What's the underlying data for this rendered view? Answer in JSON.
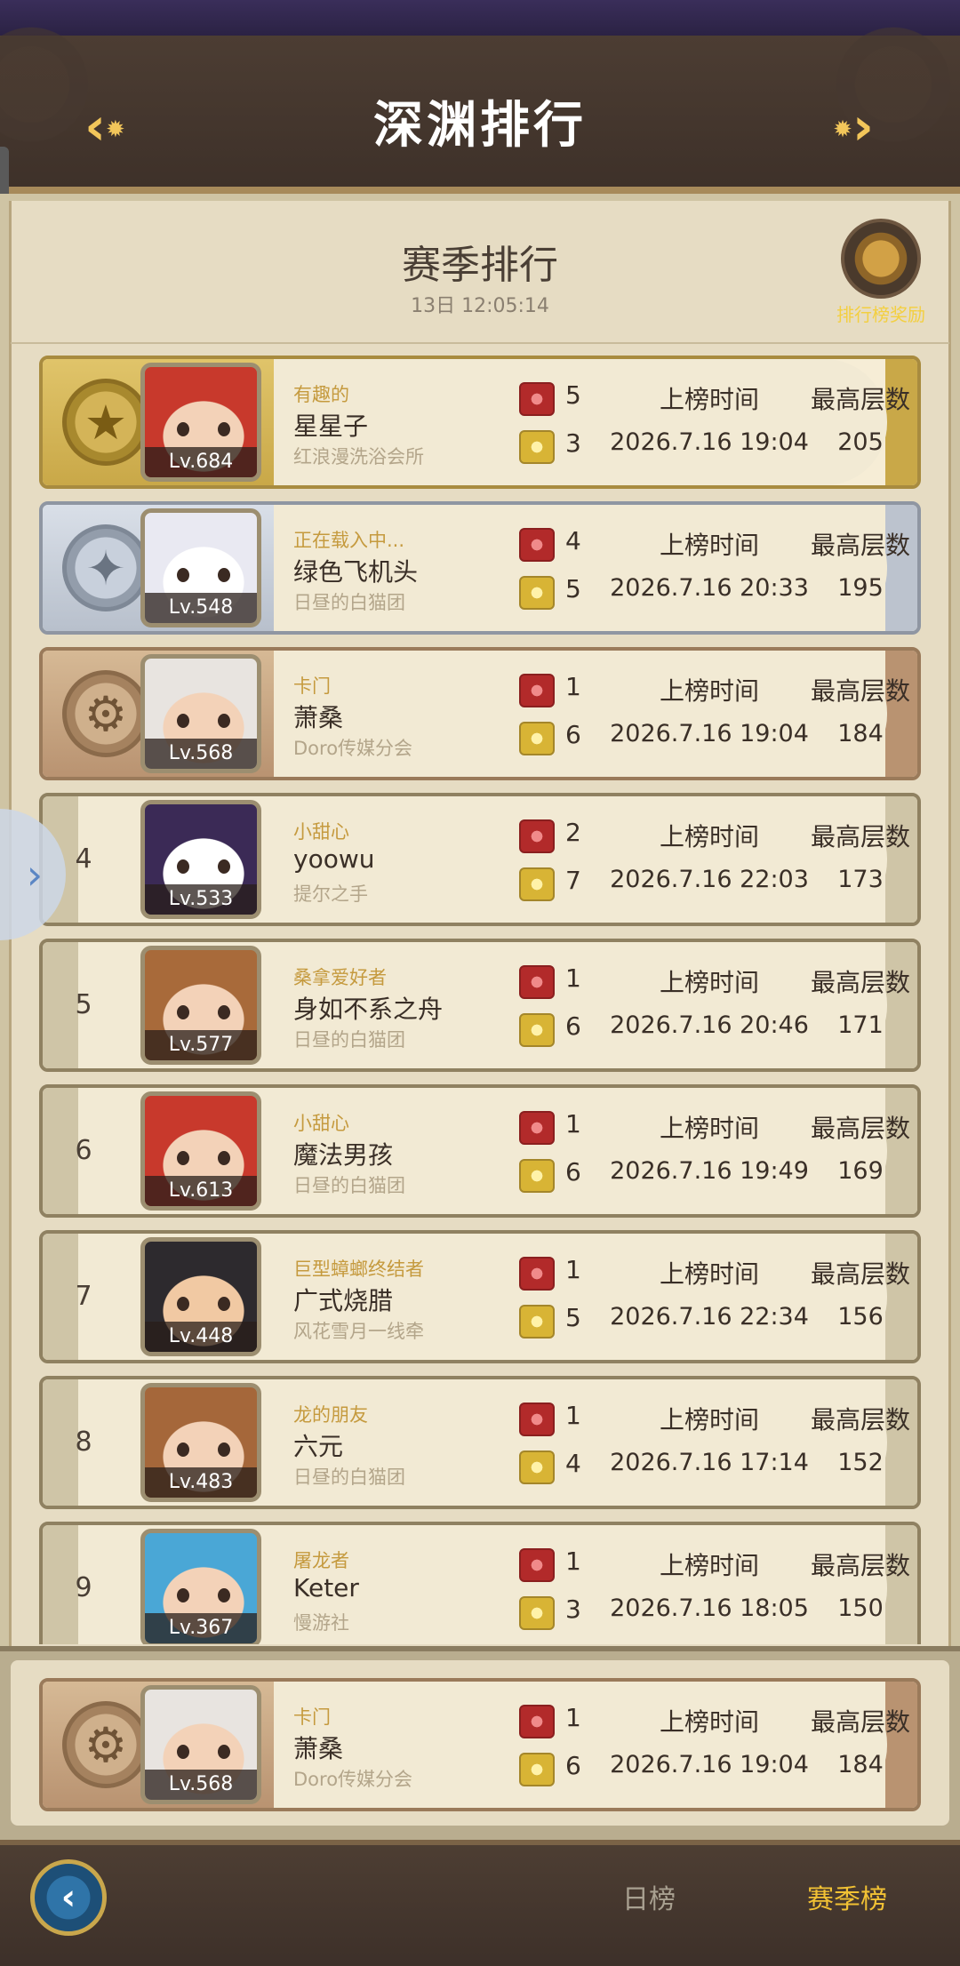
{
  "header": {
    "title": "深渊排行",
    "prev_icon": "arrow-left-gear-icon",
    "next_icon": "arrow-right-gear-icon"
  },
  "season": {
    "title": "赛季排行",
    "time_left": "13日 12:05:14",
    "reward_label": "排行榜奖励"
  },
  "columns": {
    "time": "上榜时间",
    "floor": "最高层数"
  },
  "rows": [
    {
      "rank": "1",
      "medal": "gold",
      "level": "Lv.684",
      "title": "有趣的",
      "name": "星星子",
      "guild": "红浪漫洗浴会所",
      "red": "5",
      "yellow": "3",
      "time": "2026.7.16 19:04",
      "floor": "205",
      "hair": "#c8392c",
      "skin": "#f3d2b8"
    },
    {
      "rank": "2",
      "medal": "silver",
      "level": "Lv.548",
      "title": "正在载入中...",
      "name": "绿色飞机头",
      "guild": "日昼的白猫团",
      "red": "4",
      "yellow": "5",
      "time": "2026.7.16 20:33",
      "floor": "195",
      "hair": "#e9e9f2",
      "skin": "#ffffff"
    },
    {
      "rank": "3",
      "medal": "bronze",
      "level": "Lv.568",
      "title": "卡门",
      "name": "萧桑",
      "guild": "Doro传媒分会",
      "red": "1",
      "yellow": "6",
      "time": "2026.7.16 19:04",
      "floor": "184",
      "hair": "#e8e4e0",
      "skin": "#f3d2b8"
    },
    {
      "rank": "4",
      "medal": "",
      "level": "Lv.533",
      "title": "小甜心",
      "name": "yoowu",
      "guild": "提尔之手",
      "red": "2",
      "yellow": "7",
      "time": "2026.7.16 22:03",
      "floor": "173",
      "hair": "#3b2a56",
      "skin": "#ffffff"
    },
    {
      "rank": "5",
      "medal": "",
      "level": "Lv.577",
      "title": "桑拿爱好者",
      "name": "身如不系之舟",
      "guild": "日昼的白猫团",
      "red": "1",
      "yellow": "6",
      "time": "2026.7.16 20:46",
      "floor": "171",
      "hair": "#a86a3a",
      "skin": "#f3d2b8"
    },
    {
      "rank": "6",
      "medal": "",
      "level": "Lv.613",
      "title": "小甜心",
      "name": "魔法男孩",
      "guild": "日昼的白猫团",
      "red": "1",
      "yellow": "6",
      "time": "2026.7.16 19:49",
      "floor": "169",
      "hair": "#c8392c",
      "skin": "#f3d2b8"
    },
    {
      "rank": "7",
      "medal": "",
      "level": "Lv.448",
      "title": "巨型蟑螂终结者",
      "name": "广式烧腊",
      "guild": "风花雪月一线牵",
      "red": "1",
      "yellow": "5",
      "time": "2026.7.16 22:34",
      "floor": "156",
      "hair": "#2d2a2e",
      "skin": "#f1c9a3"
    },
    {
      "rank": "8",
      "medal": "",
      "level": "Lv.483",
      "title": "龙的朋友",
      "name": "六元",
      "guild": "日昼的白猫团",
      "red": "1",
      "yellow": "4",
      "time": "2026.7.16 17:14",
      "floor": "152",
      "hair": "#a5673a",
      "skin": "#f3d2b8"
    },
    {
      "rank": "9",
      "medal": "",
      "level": "Lv.367",
      "title": "屠龙者",
      "name": "Keter",
      "guild": "慢游社",
      "red": "1",
      "yellow": "3",
      "time": "2026.7.16 18:05",
      "floor": "150",
      "hair": "#4aa7d6",
      "skin": "#f3d2b8"
    }
  ],
  "my_row": {
    "rank": "3",
    "medal": "bronze",
    "level": "Lv.568",
    "title": "卡门",
    "name": "萧桑",
    "guild": "Doro传媒分会",
    "red": "1",
    "yellow": "6",
    "time": "2026.7.16 19:04",
    "floor": "184",
    "hair": "#e8e4e0",
    "skin": "#f3d2b8"
  },
  "tabs": {
    "daily": "日榜",
    "season": "赛季榜"
  },
  "back_icon": "back-arrow-icon",
  "side_toggle_icon": "chevron-right-icon",
  "colors": {
    "accent": "#f2c234",
    "title_tag": "#c59a3e"
  }
}
